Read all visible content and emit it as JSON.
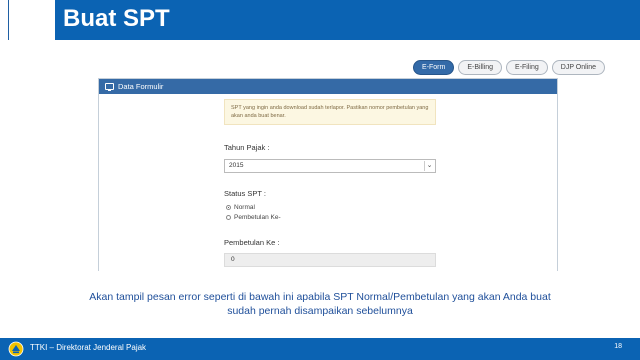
{
  "header": {
    "title": "Buat SPT"
  },
  "tabs": [
    {
      "label": "E-Form",
      "active": true
    },
    {
      "label": "E-Billing",
      "active": false
    },
    {
      "label": "E-Filing",
      "active": false
    },
    {
      "label": "DJP Online",
      "active": false
    }
  ],
  "panel": {
    "title": "Data Formulir",
    "title_icon": "monitor-icon",
    "alert_text": "SPT yang ingin anda download sudah terlapor. Pastikan nomor pembetulan yang akan anda buat benar.",
    "tahun_pajak_label": "Tahun Pajak :",
    "tahun_pajak_value": "2015",
    "status_label": "Status SPT :",
    "status_options": [
      "Normal",
      "Pembetulan Ke-"
    ],
    "status_selected": "Normal",
    "pembetulan_label": "Pembetulan Ke :",
    "pembetulan_value": "0"
  },
  "caption": {
    "line1": "Akan tampil pesan error seperti di bawah ini apabila SPT Normal/Pembetulan yang akan Anda buat",
    "line2": "sudah pernah disampaikan sebelumnya"
  },
  "footer": {
    "text": "TTKI – Direktorat Jenderal Pajak",
    "page": "18"
  },
  "colors": {
    "brand_blue": "#0b63b3",
    "panel_header": "#356aa6",
    "alert_bg": "#fcf7e2",
    "caption": "#1f4f9a"
  }
}
